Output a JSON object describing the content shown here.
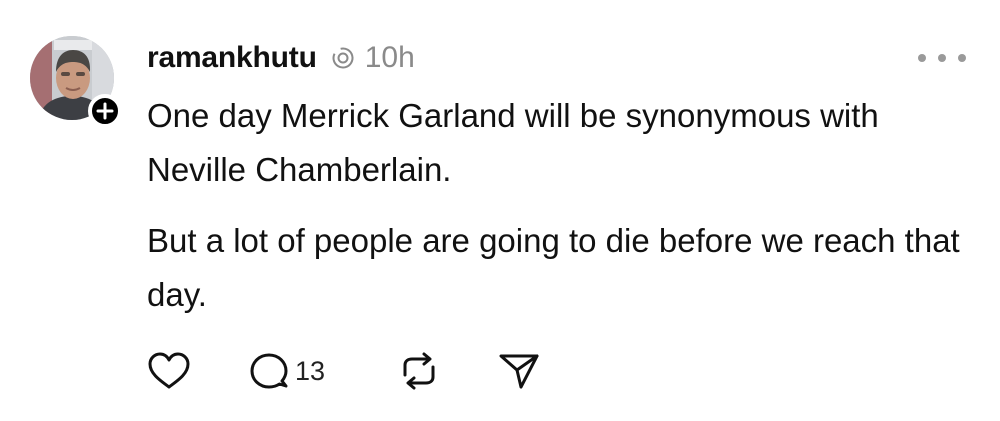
{
  "post": {
    "username": "ramankhutu",
    "timestamp": "10h",
    "paragraphs": [
      "One day Merrick Garland will be synonymous with Neville Chamberlain.",
      "But a lot of people are going to die before we reach that day."
    ],
    "reply_count": "13"
  },
  "icons": {
    "avatar": "profile-photo",
    "follow": "plus-icon",
    "status": "threads-ring-icon",
    "more": "ellipsis-icon",
    "like": "heart-icon",
    "reply": "comment-bubble-icon",
    "repost": "repost-arrows-icon",
    "share": "send-paper-plane-icon"
  },
  "colors": {
    "text": "#111111",
    "muted": "#8a8a8a",
    "background": "#ffffff"
  }
}
